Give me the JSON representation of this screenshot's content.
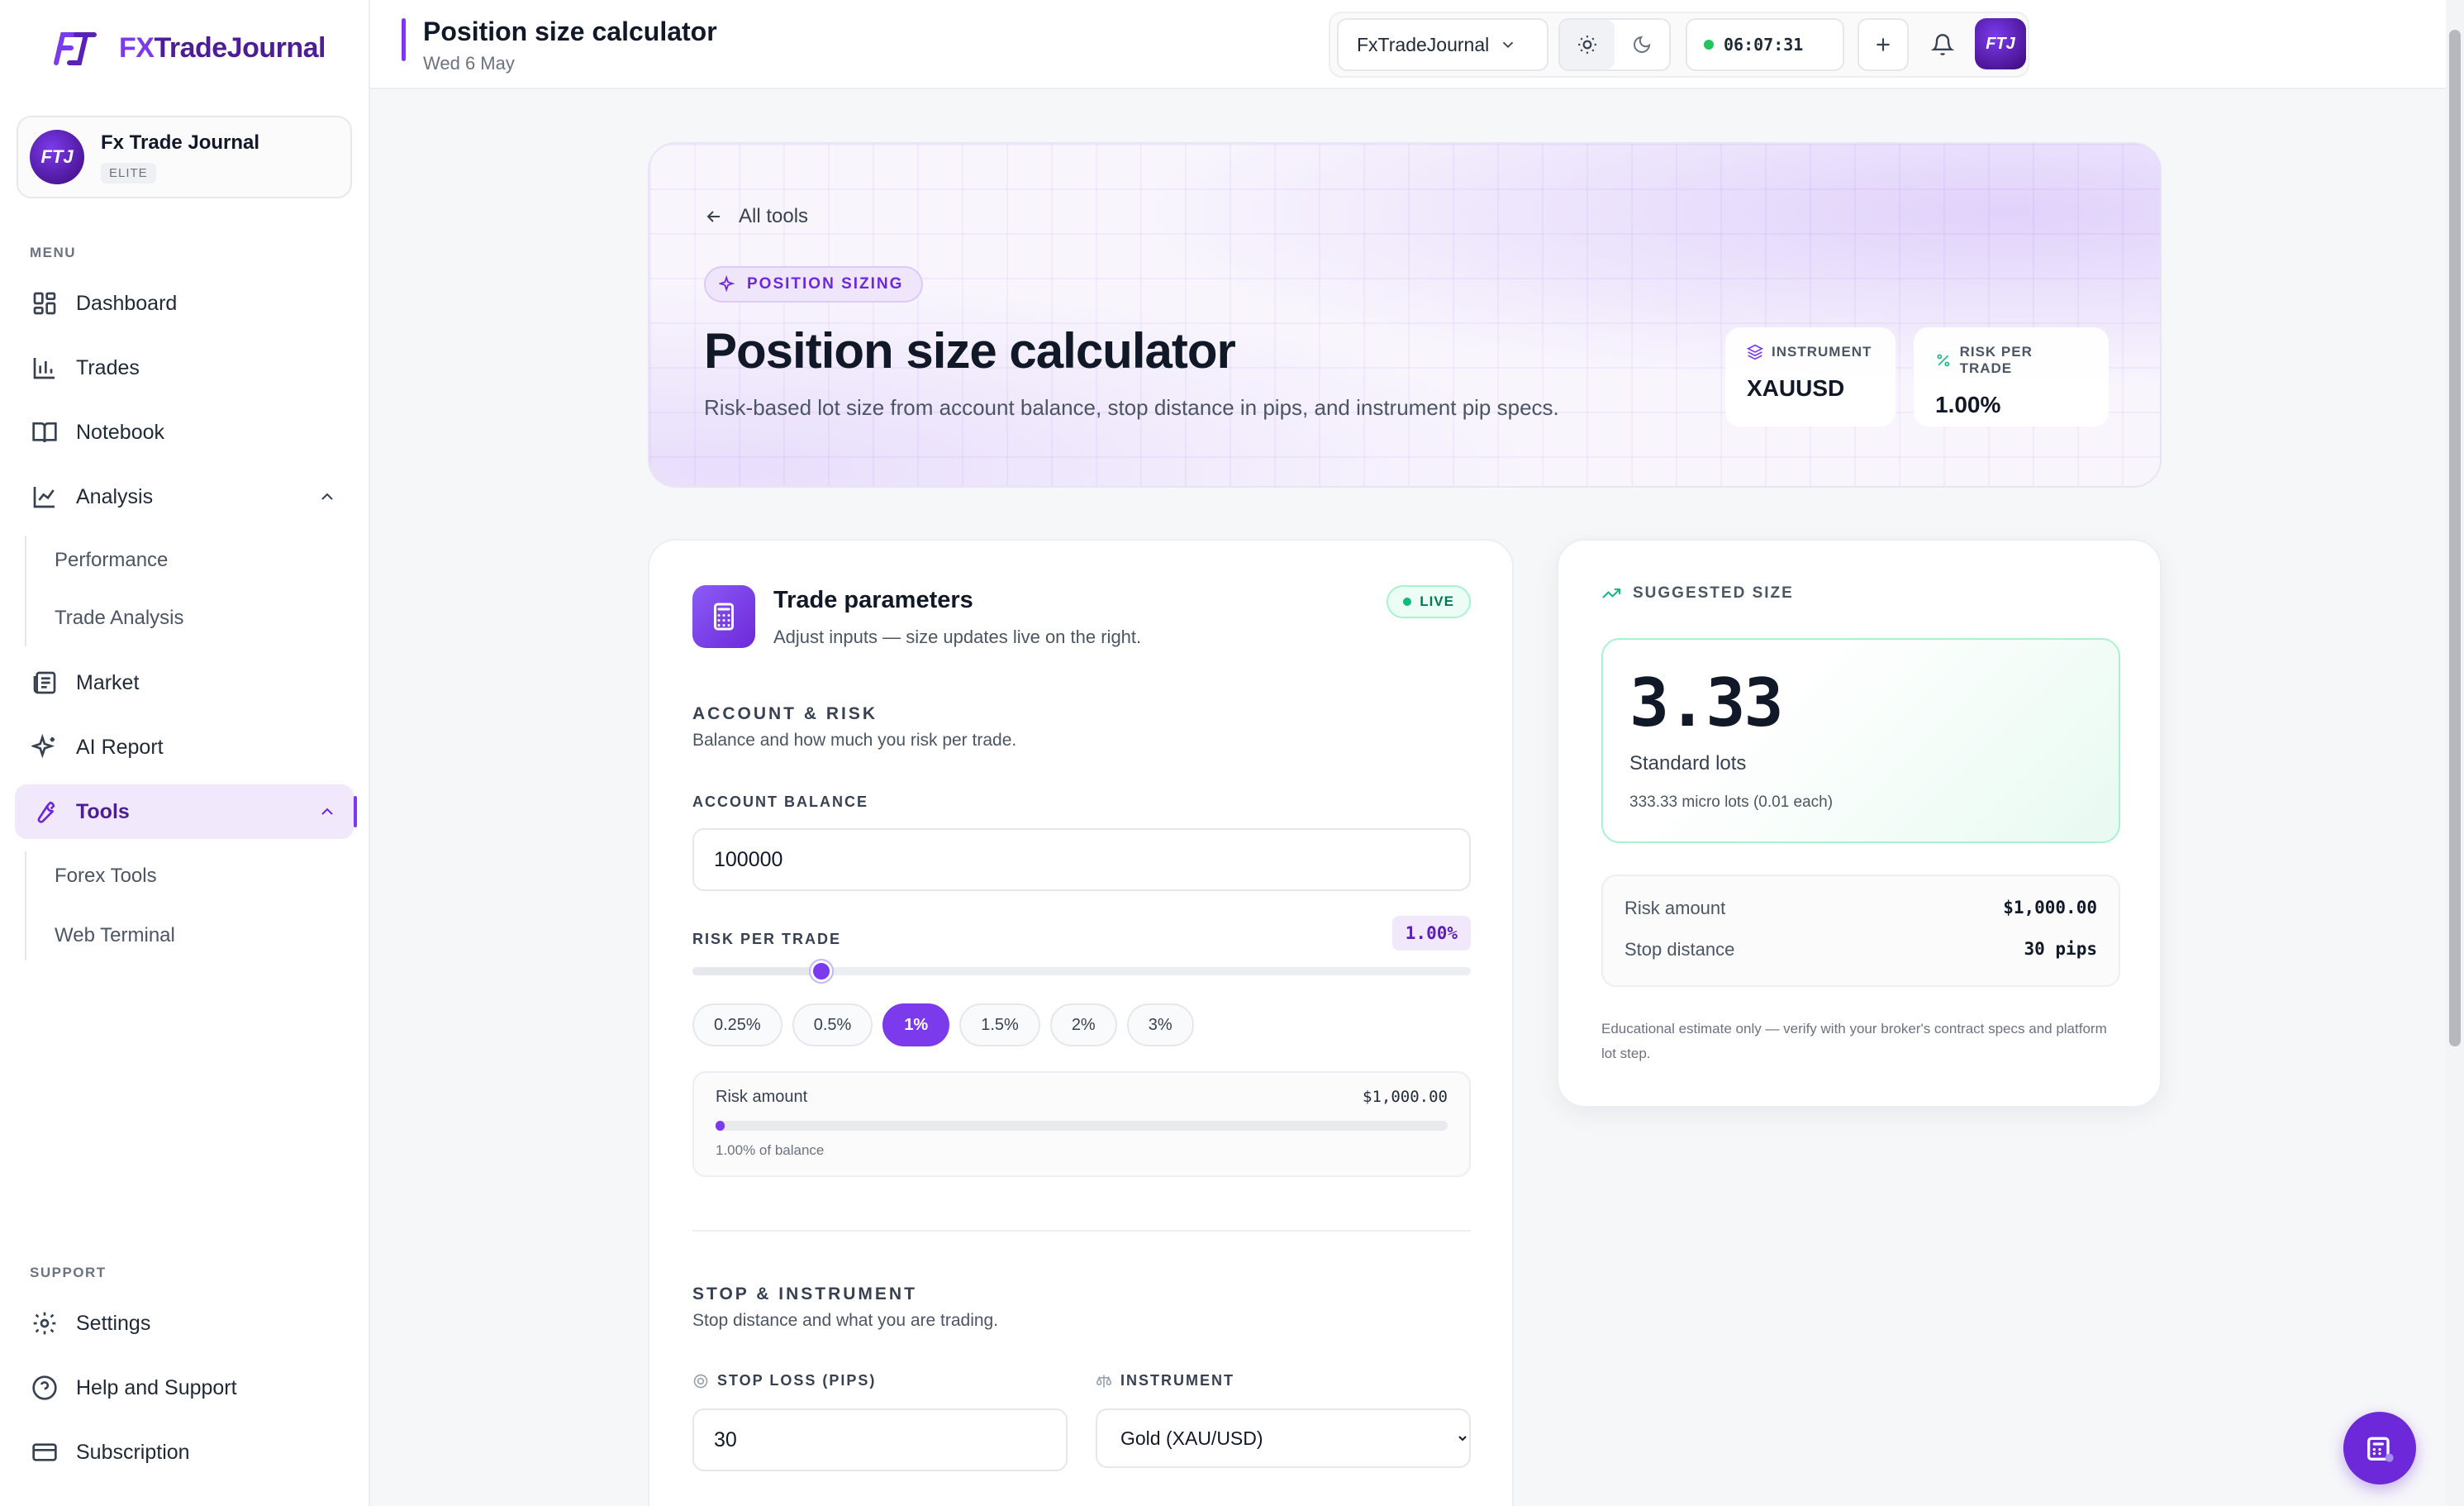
{
  "app": {
    "logo_fx": "FX",
    "logo_rest": "TradeJournal",
    "logo_mark": "FTJ"
  },
  "profile": {
    "name": "Fx Trade Journal",
    "badge": "ELITE",
    "avatar_text": "FTJ"
  },
  "sidebar": {
    "menu_label": "MENU",
    "support_label": "SUPPORT",
    "items": [
      {
        "label": "Dashboard",
        "icon": "dashboard-icon"
      },
      {
        "label": "Trades",
        "icon": "bar-chart-icon"
      },
      {
        "label": "Notebook",
        "icon": "book-icon"
      },
      {
        "label": "Analysis",
        "icon": "line-chart-icon"
      },
      {
        "label": "Market",
        "icon": "newspaper-icon"
      },
      {
        "label": "AI Report",
        "icon": "sparkles-icon"
      },
      {
        "label": "Tools",
        "icon": "wrench-icon"
      }
    ],
    "analysis_sub": [
      "Performance",
      "Trade Analysis"
    ],
    "tools_sub": [
      "Forex Tools",
      "Web Terminal"
    ],
    "support_items": [
      {
        "label": "Settings",
        "icon": "gear-icon"
      },
      {
        "label": "Help and Support",
        "icon": "help-circle-icon"
      },
      {
        "label": "Subscription",
        "icon": "credit-card-icon"
      }
    ]
  },
  "topbar": {
    "title": "Position size calculator",
    "date": "Wed 6 May",
    "account_select": "FxTradeJournal",
    "clock": "06:07:31",
    "avatar_text": "FTJ"
  },
  "hero": {
    "back_label": "All tools",
    "chip": "POSITION SIZING",
    "title": "Position size calculator",
    "subtitle": "Risk-based lot size from account balance, stop distance in pips, and instrument pip specs.",
    "instrument_label": "INSTRUMENT",
    "instrument_value": "XAUUSD",
    "risk_label": "RISK PER TRADE",
    "risk_value": "1.00%"
  },
  "params": {
    "title": "Trade parameters",
    "subtitle": "Adjust inputs — size updates live on the right.",
    "live": "LIVE",
    "account_section": "ACCOUNT & RISK",
    "account_section_sub": "Balance and how much you risk per trade.",
    "balance_label": "ACCOUNT BALANCE",
    "balance_value": "100000",
    "risk_label": "RISK PER TRADE",
    "risk_badge": "1.00%",
    "risk_slider_fraction": 0.166,
    "presets": [
      "0.25%",
      "0.5%",
      "1%",
      "1.5%",
      "2%",
      "3%"
    ],
    "preset_selected": "1%",
    "risk_amount_label": "Risk amount",
    "risk_amount_value": "$1,000.00",
    "risk_amount_fraction": 0.01,
    "risk_amount_note": "1.00% of balance",
    "stop_section": "STOP & INSTRUMENT",
    "stop_section_sub": "Stop distance and what you are trading.",
    "stop_label": "STOP LOSS (PIPS)",
    "stop_value": "30",
    "instrument_label": "INSTRUMENT",
    "instrument_value": "Gold (XAU/USD)"
  },
  "suggested": {
    "head": "SUGGESTED SIZE",
    "lots": "3.33",
    "unit": "Standard lots",
    "micro": "333.33 micro lots (0.01 each)",
    "risk_amount_label": "Risk amount",
    "risk_amount_value": "$1,000.00",
    "stop_label": "Stop distance",
    "stop_value": "30 pips",
    "disclaimer": "Educational estimate only — verify with your broker's contract specs and platform lot step."
  },
  "colors": {
    "accent": "#7c3aed",
    "accent_dark": "#4c1d95",
    "live_green": "#10b981"
  }
}
